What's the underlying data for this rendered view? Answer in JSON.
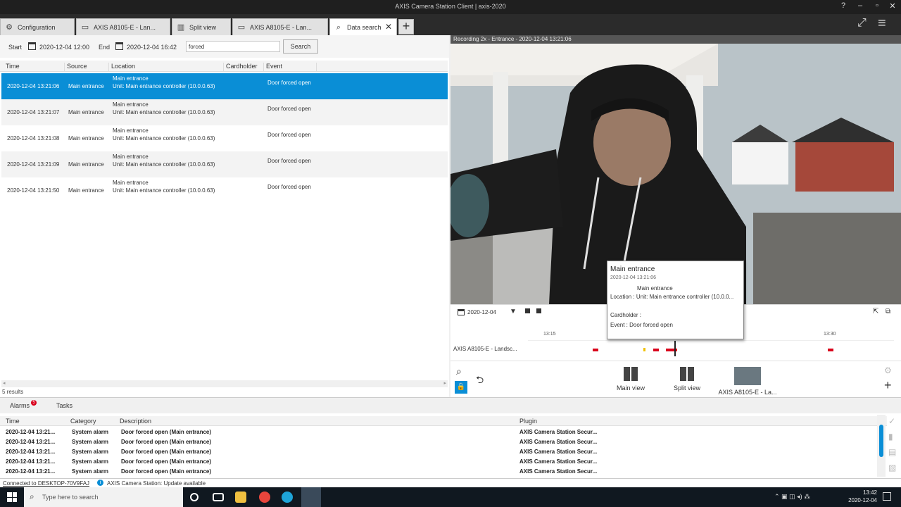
{
  "window": {
    "title": "AXIS Camera Station Client | axis-2020"
  },
  "tabs": [
    {
      "label": "Configuration",
      "icon": "gear-icon"
    },
    {
      "label": "AXIS A8105-E - Lan...",
      "icon": "monitor-icon"
    },
    {
      "label": "Split view",
      "icon": "split-icon"
    },
    {
      "label": "AXIS A8105-E - Lan...",
      "icon": "monitor-icon"
    },
    {
      "label": "Data search",
      "icon": "search-icon"
    }
  ],
  "search": {
    "start_label": "Start",
    "start_value": "2020-12-04 12:00",
    "end_label": "End",
    "end_value": "2020-12-04 16:42",
    "query": "forced",
    "button": "Search"
  },
  "table": {
    "headers": [
      "Time",
      "Source",
      "Location",
      "Cardholder",
      "Event"
    ],
    "rows": [
      {
        "time": "2020-12-04 13:21:06",
        "source": "Main entrance",
        "loc1": "Main entrance",
        "loc2": "Unit: Main entrance controller (10.0.0.63)",
        "event": "Door forced open"
      },
      {
        "time": "2020-12-04 13:21:07",
        "source": "Main entrance",
        "loc1": "Main entrance",
        "loc2": "Unit: Main entrance controller (10.0.0.63)",
        "event": "Door forced open"
      },
      {
        "time": "2020-12-04 13:21:08",
        "source": "Main entrance",
        "loc1": "Main entrance",
        "loc2": "Unit: Main entrance controller (10.0.0.63)",
        "event": "Door forced open"
      },
      {
        "time": "2020-12-04 13:21:09",
        "source": "Main entrance",
        "loc1": "Main entrance",
        "loc2": "Unit: Main entrance controller (10.0.0.63)",
        "event": "Door forced open"
      },
      {
        "time": "2020-12-04 13:21:50",
        "source": "Main entrance",
        "loc1": "Main entrance",
        "loc2": "Unit: Main entrance controller (10.0.0.63)",
        "event": "Door forced open"
      }
    ],
    "results": "5 results"
  },
  "video": {
    "overlay": "Recording 2x - Entrance - 2020-12-04 13:21:06"
  },
  "tooltip": {
    "title": "Main entrance",
    "time": "2020-12-04 13:21:06",
    "source": "Main entrance",
    "location": "Location : Unit: Main entrance controller (10.0.0...",
    "cardholder": "Cardholder :",
    "event": "Event : Door forced open"
  },
  "timeline": {
    "date": "2020-12-04",
    "camera_label": "AXIS A8105-E - Landsc...",
    "tick_left": "13:15",
    "tick_right": "13:30"
  },
  "controls": {
    "main_view": "Main view",
    "split_view": "Split view",
    "camera_thumb": "AXIS A8105-E - La..."
  },
  "bottom": {
    "tabs": [
      "Alarms",
      "Tasks"
    ],
    "alarm_badge": "5",
    "headers": [
      "Time",
      "Category",
      "Description",
      "Plugin"
    ],
    "rows": [
      {
        "time": "2020-12-04 13:21...",
        "category": "System alarm",
        "desc": "Door forced open (Main entrance)",
        "plugin": "AXIS Camera Station Secur..."
      },
      {
        "time": "2020-12-04 13:21...",
        "category": "System alarm",
        "desc": "Door forced open (Main entrance)",
        "plugin": "AXIS Camera Station Secur..."
      },
      {
        "time": "2020-12-04 13:21...",
        "category": "System alarm",
        "desc": "Door forced open (Main entrance)",
        "plugin": "AXIS Camera Station Secur..."
      },
      {
        "time": "2020-12-04 13:21...",
        "category": "System alarm",
        "desc": "Door forced open (Main entrance)",
        "plugin": "AXIS Camera Station Secur..."
      },
      {
        "time": "2020-12-04 13:21...",
        "category": "System alarm",
        "desc": "Door forced open (Main entrance)",
        "plugin": "AXIS Camera Station Secur..."
      }
    ]
  },
  "status": {
    "connected": "Connected to DESKTOP-70V9FAJ",
    "update": "AXIS Camera Station: Update available"
  },
  "taskbar": {
    "search_placeholder": "Type here to search",
    "time": "13:42",
    "date": "2020-12-04"
  },
  "colors": {
    "accent": "#0a8ed6",
    "alarm_red": "#d9001b"
  }
}
